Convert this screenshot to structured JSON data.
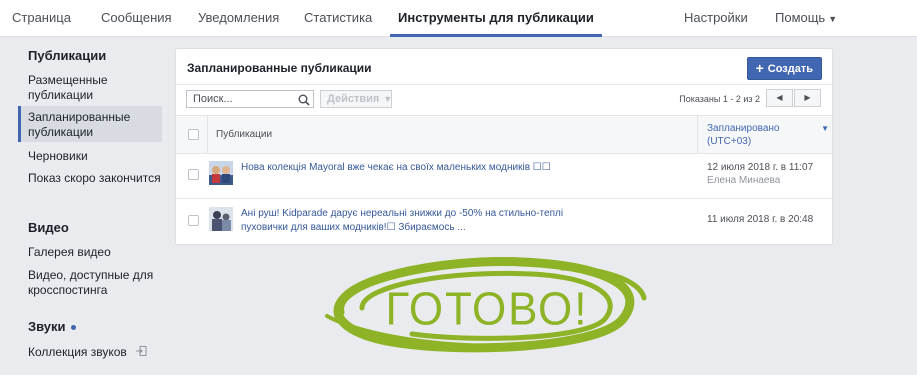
{
  "topnav": {
    "items": [
      "Страница",
      "Сообщения",
      "Уведомления",
      "Статистика",
      "Инструменты для публикации"
    ],
    "settings": "Настройки",
    "help": "Помощь"
  },
  "sidebar": {
    "sections": [
      {
        "title": "Публикации",
        "items": [
          "Размещенные публикации",
          "Запланированные публикации",
          "Черновики",
          "Показ скоро закончится"
        ]
      },
      {
        "title": "Видео",
        "items": [
          "Галерея видео",
          "Видео, доступные для кросспостинга"
        ]
      },
      {
        "title": "Звуки",
        "items": [
          "Коллекция звуков"
        ]
      }
    ],
    "active_item": "Запланированные публикации"
  },
  "panel": {
    "title": "Запланированные публикации",
    "create_label": "Создать",
    "search_placeholder": "Поиск...",
    "actions_label": "Действия",
    "pager_text": "Показаны 1 - 2 из 2",
    "table": {
      "col_publications": "Публикации",
      "col_scheduled": "Запланировано (UTC+03)",
      "rows": [
        {
          "text": "Нова колекція Mayoral вже чекає на своїх маленьких модників ☐☐",
          "date": "12 июля 2018 г. в 11:07",
          "author": "Елена Минаева"
        },
        {
          "text": "Ані руш! Kidparade дарує нереальні знижки до -50% на стильно-теплі пуховички для ваших модників!☐ Збираємось ...",
          "date": "11 июля 2018 г. в 20:48",
          "author": ""
        }
      ]
    }
  },
  "overlay": {
    "text": "ГОТОВО!",
    "color": "#8fb327"
  },
  "colors": {
    "accent": "#4267b2",
    "background": "#e9ebee"
  },
  "icons": [
    "search-icon",
    "plus-icon",
    "chevron-down-icon",
    "chevron-left-icon",
    "chevron-right-icon",
    "sort-down-icon",
    "external-link-icon"
  ]
}
